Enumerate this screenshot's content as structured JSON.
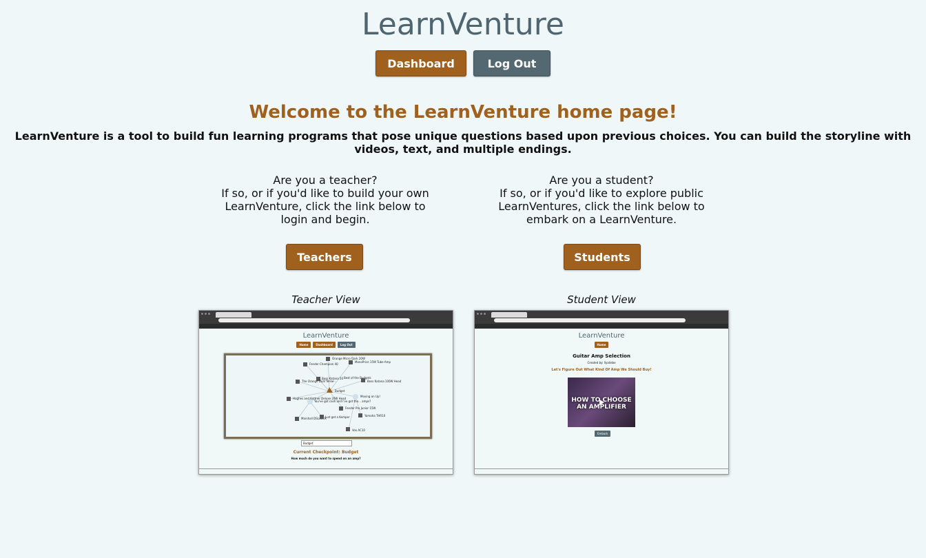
{
  "app": {
    "title": "LearnVenture"
  },
  "nav": {
    "dashboard_label": "Dashboard",
    "logout_label": "Log Out"
  },
  "welcome": {
    "heading": "Welcome to the LearnVenture home page!",
    "intro": "LearnVenture is a tool to build fun learning programs that pose unique questions based upon previous choices. You can build the storyline with videos, text, and multiple endings."
  },
  "teacher": {
    "question": "Are you a teacher?",
    "text": "If so, or if you'd like to build your own LearnVenture, click the link below to login and begin.",
    "button": "Teachers",
    "caption": "Teacher View"
  },
  "student": {
    "question": "Are you a student?",
    "text": "If so, or if you'd like to explore public LearnVentures, click the link below to embark on a LearnVenture.",
    "button": "Students",
    "caption": "Student View"
  },
  "teacher_shot": {
    "title": "LearnVenture",
    "nav": [
      "Home",
      "Dashboard",
      "Log Out"
    ],
    "nodes": [
      "Orange Micro Dark 20W",
      "Fender Champion 40",
      "MonoPrice 15W Tube Amp",
      "Boss Katana 50",
      "Best of the Budgets",
      "The Orange Dual Terror",
      "Boss Katana 100W Head",
      "Budget",
      "Hughes and Kettner Deluxe 20W Head",
      "Moving on Up!",
      "You've got cash and I've got the... amps?",
      "Fender Pro Junior 15W",
      "Marshall DSL40CR",
      "Just get a Kemper",
      "Yamaha THR10",
      "Vox AC10"
    ],
    "select_value": "Budget",
    "checkpoint": "Current Checkpoint: Budget",
    "question": "How much do you want to spend on an amp?"
  },
  "student_shot": {
    "title": "LearnVenture",
    "nav": [
      "Home"
    ],
    "heading": "Guitar Amp Selection",
    "created_by": "Created by: llyaliebe",
    "question": "Let's Figure Out What Kind Of Amp We Should Buy!",
    "video_text": "HOW TO CHOOSE AN AMPLIFIER",
    "embark": "Embark"
  },
  "colors": {
    "accent": "#a0601e",
    "slate": "#536870",
    "background": "#eff7f8",
    "title": "#4f6670"
  }
}
